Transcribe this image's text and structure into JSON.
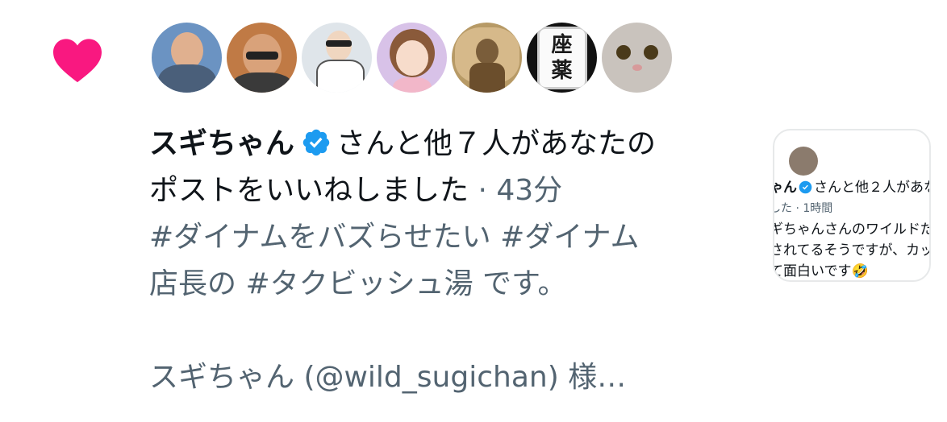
{
  "notification": {
    "icon": "heart-icon",
    "icon_color": "#f91880",
    "avatars": [
      {
        "name": "avatar-1",
        "bg": "#5b87b8"
      },
      {
        "name": "avatar-2",
        "bg": "#b86a3c"
      },
      {
        "name": "avatar-3",
        "bg": "#9aa8b5"
      },
      {
        "name": "avatar-4",
        "bg": "#c9a7d6"
      },
      {
        "name": "avatar-5",
        "bg": "#8a6a3d"
      },
      {
        "name": "avatar-6",
        "bg": "#111111",
        "tile_top": "座",
        "tile_bottom": "薬"
      },
      {
        "name": "avatar-7",
        "bg": "#c9c3bd"
      }
    ],
    "actor_name": "スギちゃん",
    "verified_color": "#1d9bf0",
    "action_line1": "さんと他７人があなたの",
    "action_line2": "ポストをいいねしました",
    "separator": " · ",
    "time": "43分",
    "post_line1": "#ダイナムをバズらせたい #ダイナム",
    "post_line2": "店長の #タクビッシュ湯 です。",
    "post_line3": "スギちゃん (@wild_sugichan) 様…"
  },
  "thumbnail": {
    "line1_name": "ゃん",
    "line1_rest": "さんと他２人があな",
    "line2": "した · 1時間",
    "line3": "ギちゃんさんのワイルドだ",
    "line4": "されてるそうですが、カッ",
    "line5": "て面白いです🤣"
  }
}
